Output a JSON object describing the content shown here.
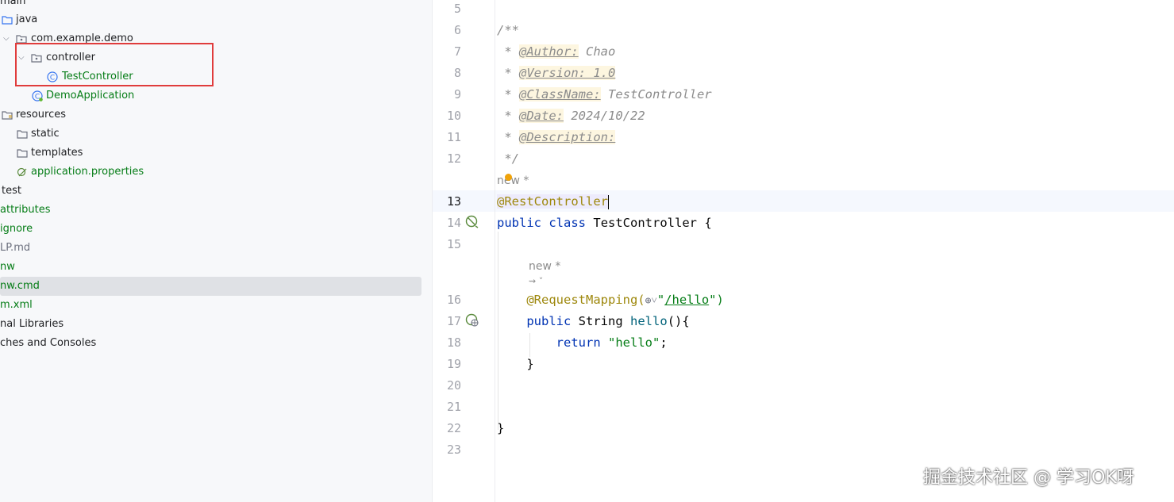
{
  "tree": {
    "items": [
      {
        "label": "main",
        "color": "#1e1f22"
      },
      {
        "label": "java",
        "color": "#1e1f22"
      },
      {
        "label": "com.example.demo",
        "color": "#1e1f22"
      },
      {
        "label": "controller",
        "color": "#1e1f22"
      },
      {
        "label": "TestController",
        "color": "#067d17"
      },
      {
        "label": "DemoApplication",
        "color": "#067d17"
      },
      {
        "label": "resources",
        "color": "#1e1f22"
      },
      {
        "label": "static",
        "color": "#1e1f22"
      },
      {
        "label": "templates",
        "color": "#1e1f22"
      },
      {
        "label": "application.properties",
        "color": "#067d17"
      },
      {
        "label": "test",
        "color": "#1e1f22"
      },
      {
        "label": "attributes",
        "color": "#067d17"
      },
      {
        "label": "ignore",
        "color": "#067d17"
      },
      {
        "label": "LP.md",
        "color": "#6c707e"
      },
      {
        "label": "nw",
        "color": "#067d17"
      },
      {
        "label": "nw.cmd",
        "color": "#067d17"
      },
      {
        "label": "m.xml",
        "color": "#067d17"
      },
      {
        "label": "nal Libraries",
        "color": "#1e1f22"
      },
      {
        "label": "ches and Consoles",
        "color": "#1e1f22"
      }
    ]
  },
  "editor": {
    "line_numbers": [
      "5",
      "6",
      "7",
      "8",
      "9",
      "10",
      "11",
      "12",
      "13",
      "14",
      "15",
      "16",
      "17",
      "18",
      "19",
      "20",
      "21",
      "22",
      "23"
    ],
    "doc": {
      "open": "/**",
      "star": " * ",
      "author_tag": "@Author:",
      "author_val": " Chao",
      "version_tag": "@Version: 1.0",
      "classname_tag": "@ClassName:",
      "classname_val": " TestController",
      "date_tag": "@Date:",
      "date_val": " 2024/10/22",
      "desc_tag": "@Description:",
      "close": " */"
    },
    "hint_new_1": "new *",
    "annotation_rest": "@RestController",
    "kw_public": "public",
    "kw_class": "class",
    "class_name": "TestController {",
    "hint_new_2": "new *",
    "hint_ai": "⇝ ˅",
    "annotation_req": "@RequestMapping(",
    "globe": "⊕˅",
    "req_path_q1": "\"",
    "req_path": "/hello",
    "req_path_q2": "\")",
    "kw_public2": "public",
    "ret_type": "String",
    "method": "hello",
    "method_tail": "(){",
    "kw_return": "return",
    "ret_str": "\"hello\"",
    "semicolon": ";",
    "close_brace_inner": "}",
    "close_brace_outer": "}"
  },
  "watermark": "掘金技术社区 @ 学习OK呀",
  "colors": {
    "annotation": "#9e880d",
    "keyword": "#0033b3",
    "string": "#067d17",
    "highlight_box": "#e03c3c"
  }
}
